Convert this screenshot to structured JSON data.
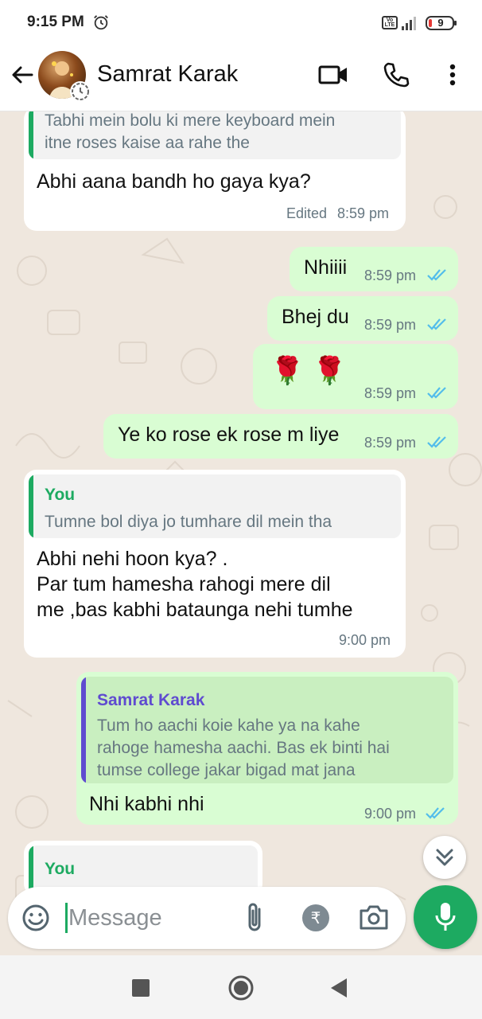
{
  "status_bar": {
    "time": "9:15 PM",
    "volte": "Vo LTE",
    "battery": "9"
  },
  "header": {
    "contact_name": "Samrat Karak"
  },
  "messages": [
    {
      "quote_text": [
        "Tabhi mein bolu ki mere keyboard mein",
        "itne roses kaise aa rahe the"
      ],
      "text": "Abhi aana bandh ho gaya kya?",
      "edited": "Edited",
      "time": "8:59 pm"
    },
    {
      "text": "Nhiiii",
      "time": "8:59 pm"
    },
    {
      "text": "Bhej du",
      "time": "8:59 pm"
    },
    {
      "emoji": "🌹 🌹",
      "time": "8:59 pm"
    },
    {
      "text": "Ye ko rose ek rose m liye",
      "time": "8:59 pm"
    },
    {
      "quote_name": "You",
      "quote_text": [
        "Tumne bol diya jo tumhare dil mein tha"
      ],
      "text_lines": [
        "Abhi nehi hoon kya?  .",
        "Par tum hamesha rahogi mere dil",
        "me ,bas kabhi bataunga nehi tumhe"
      ],
      "time": "9:00 pm"
    },
    {
      "quote_name": "Samrat Karak",
      "quote_text": [
        "Tum ho aachi koie kahe ya na kahe",
        "rahoge hamesha aachi. Bas ek binti hai",
        "tumse college jakar bigad mat jana"
      ],
      "text": "Nhi kabhi nhi",
      "time": "9:00 pm"
    },
    {
      "quote_name": "You"
    }
  ],
  "composer": {
    "placeholder": "Message"
  },
  "colors": {
    "accent_green": "#1daa61",
    "you_quote_name": "#1daa61",
    "contact_quote_name": "#5f4bd0",
    "tick_blue": "#53bdeb"
  }
}
